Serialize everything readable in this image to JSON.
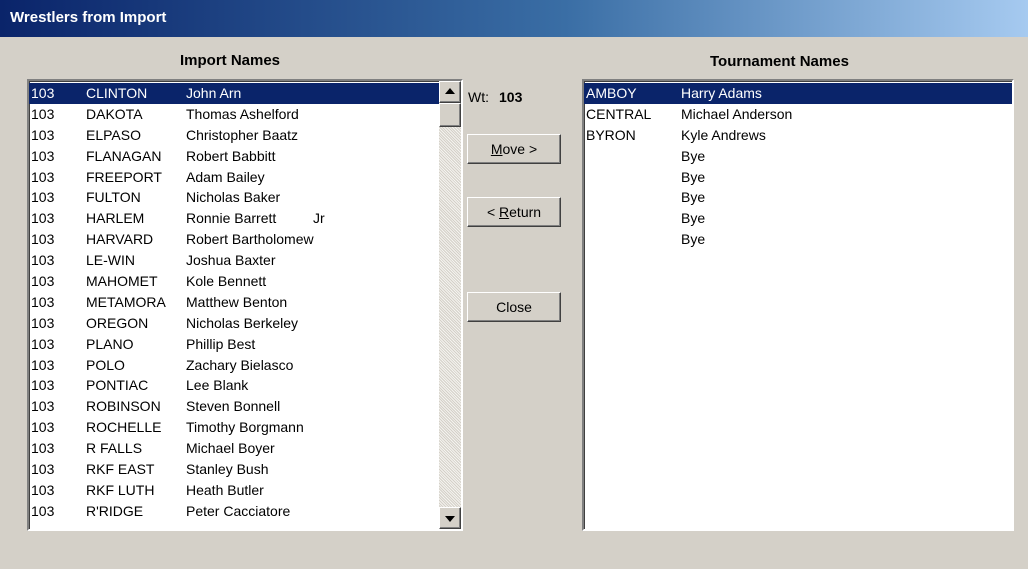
{
  "window": {
    "title": "Wrestlers from Import"
  },
  "import_list": {
    "heading": "Import Names",
    "rows": [
      {
        "wt": "103",
        "school": "CLINTON",
        "name": "John Arn",
        "suffix": "",
        "selected": true
      },
      {
        "wt": "103",
        "school": "DAKOTA",
        "name": "Thomas Ashelford",
        "suffix": ""
      },
      {
        "wt": "103",
        "school": "ELPASO",
        "name": "Christopher Baatz",
        "suffix": ""
      },
      {
        "wt": "103",
        "school": "FLANAGAN",
        "name": "Robert Babbitt",
        "suffix": ""
      },
      {
        "wt": "103",
        "school": "FREEPORT",
        "name": "Adam Bailey",
        "suffix": ""
      },
      {
        "wt": "103",
        "school": "FULTON",
        "name": "Nicholas Baker",
        "suffix": ""
      },
      {
        "wt": "103",
        "school": "HARLEM",
        "name": "Ronnie Barrett",
        "suffix": "Jr"
      },
      {
        "wt": "103",
        "school": "HARVARD",
        "name": "Robert Bartholomew",
        "suffix": ""
      },
      {
        "wt": "103",
        "school": "LE-WIN",
        "name": "Joshua Baxter",
        "suffix": ""
      },
      {
        "wt": "103",
        "school": "MAHOMET",
        "name": "Kole Bennett",
        "suffix": ""
      },
      {
        "wt": "103",
        "school": "METAMORA",
        "name": "Matthew Benton",
        "suffix": ""
      },
      {
        "wt": "103",
        "school": "OREGON",
        "name": "Nicholas Berkeley",
        "suffix": ""
      },
      {
        "wt": "103",
        "school": "PLANO",
        "name": "Phillip Best",
        "suffix": ""
      },
      {
        "wt": "103",
        "school": "POLO",
        "name": "Zachary Bielasco",
        "suffix": ""
      },
      {
        "wt": "103",
        "school": "PONTIAC",
        "name": "Lee Blank",
        "suffix": ""
      },
      {
        "wt": "103",
        "school": "ROBINSON",
        "name": "Steven Bonnell",
        "suffix": ""
      },
      {
        "wt": "103",
        "school": "ROCHELLE",
        "name": "Timothy Borgmann",
        "suffix": ""
      },
      {
        "wt": "103",
        "school": "R FALLS",
        "name": "Michael Boyer",
        "suffix": ""
      },
      {
        "wt": "103",
        "school": "RKF EAST",
        "name": "Stanley Bush",
        "suffix": ""
      },
      {
        "wt": "103",
        "school": "RKF LUTH",
        "name": "Heath Butler",
        "suffix": ""
      },
      {
        "wt": "103",
        "school": "R'RIDGE",
        "name": "Peter Cacciatore",
        "suffix": ""
      }
    ]
  },
  "weight": {
    "label": "Wt:",
    "value": "103"
  },
  "buttons": {
    "move": {
      "pre": "",
      "key": "M",
      "post": "ove >"
    },
    "return": {
      "pre": "< ",
      "key": "R",
      "post": "eturn"
    },
    "close": "Close"
  },
  "tournament_list": {
    "heading": "Tournament Names",
    "rows": [
      {
        "school": "AMBOY",
        "name": "Harry Adams",
        "selected": true
      },
      {
        "school": "CENTRAL",
        "name": "Michael Anderson"
      },
      {
        "school": "BYRON",
        "name": "Kyle Andrews"
      },
      {
        "school": "",
        "name": "Bye"
      },
      {
        "school": "",
        "name": "Bye"
      },
      {
        "school": "",
        "name": "Bye"
      },
      {
        "school": "",
        "name": "Bye"
      },
      {
        "school": "",
        "name": "Bye"
      }
    ]
  },
  "colors": {
    "selection": "#0a246a",
    "face": "#d4d0c8"
  }
}
